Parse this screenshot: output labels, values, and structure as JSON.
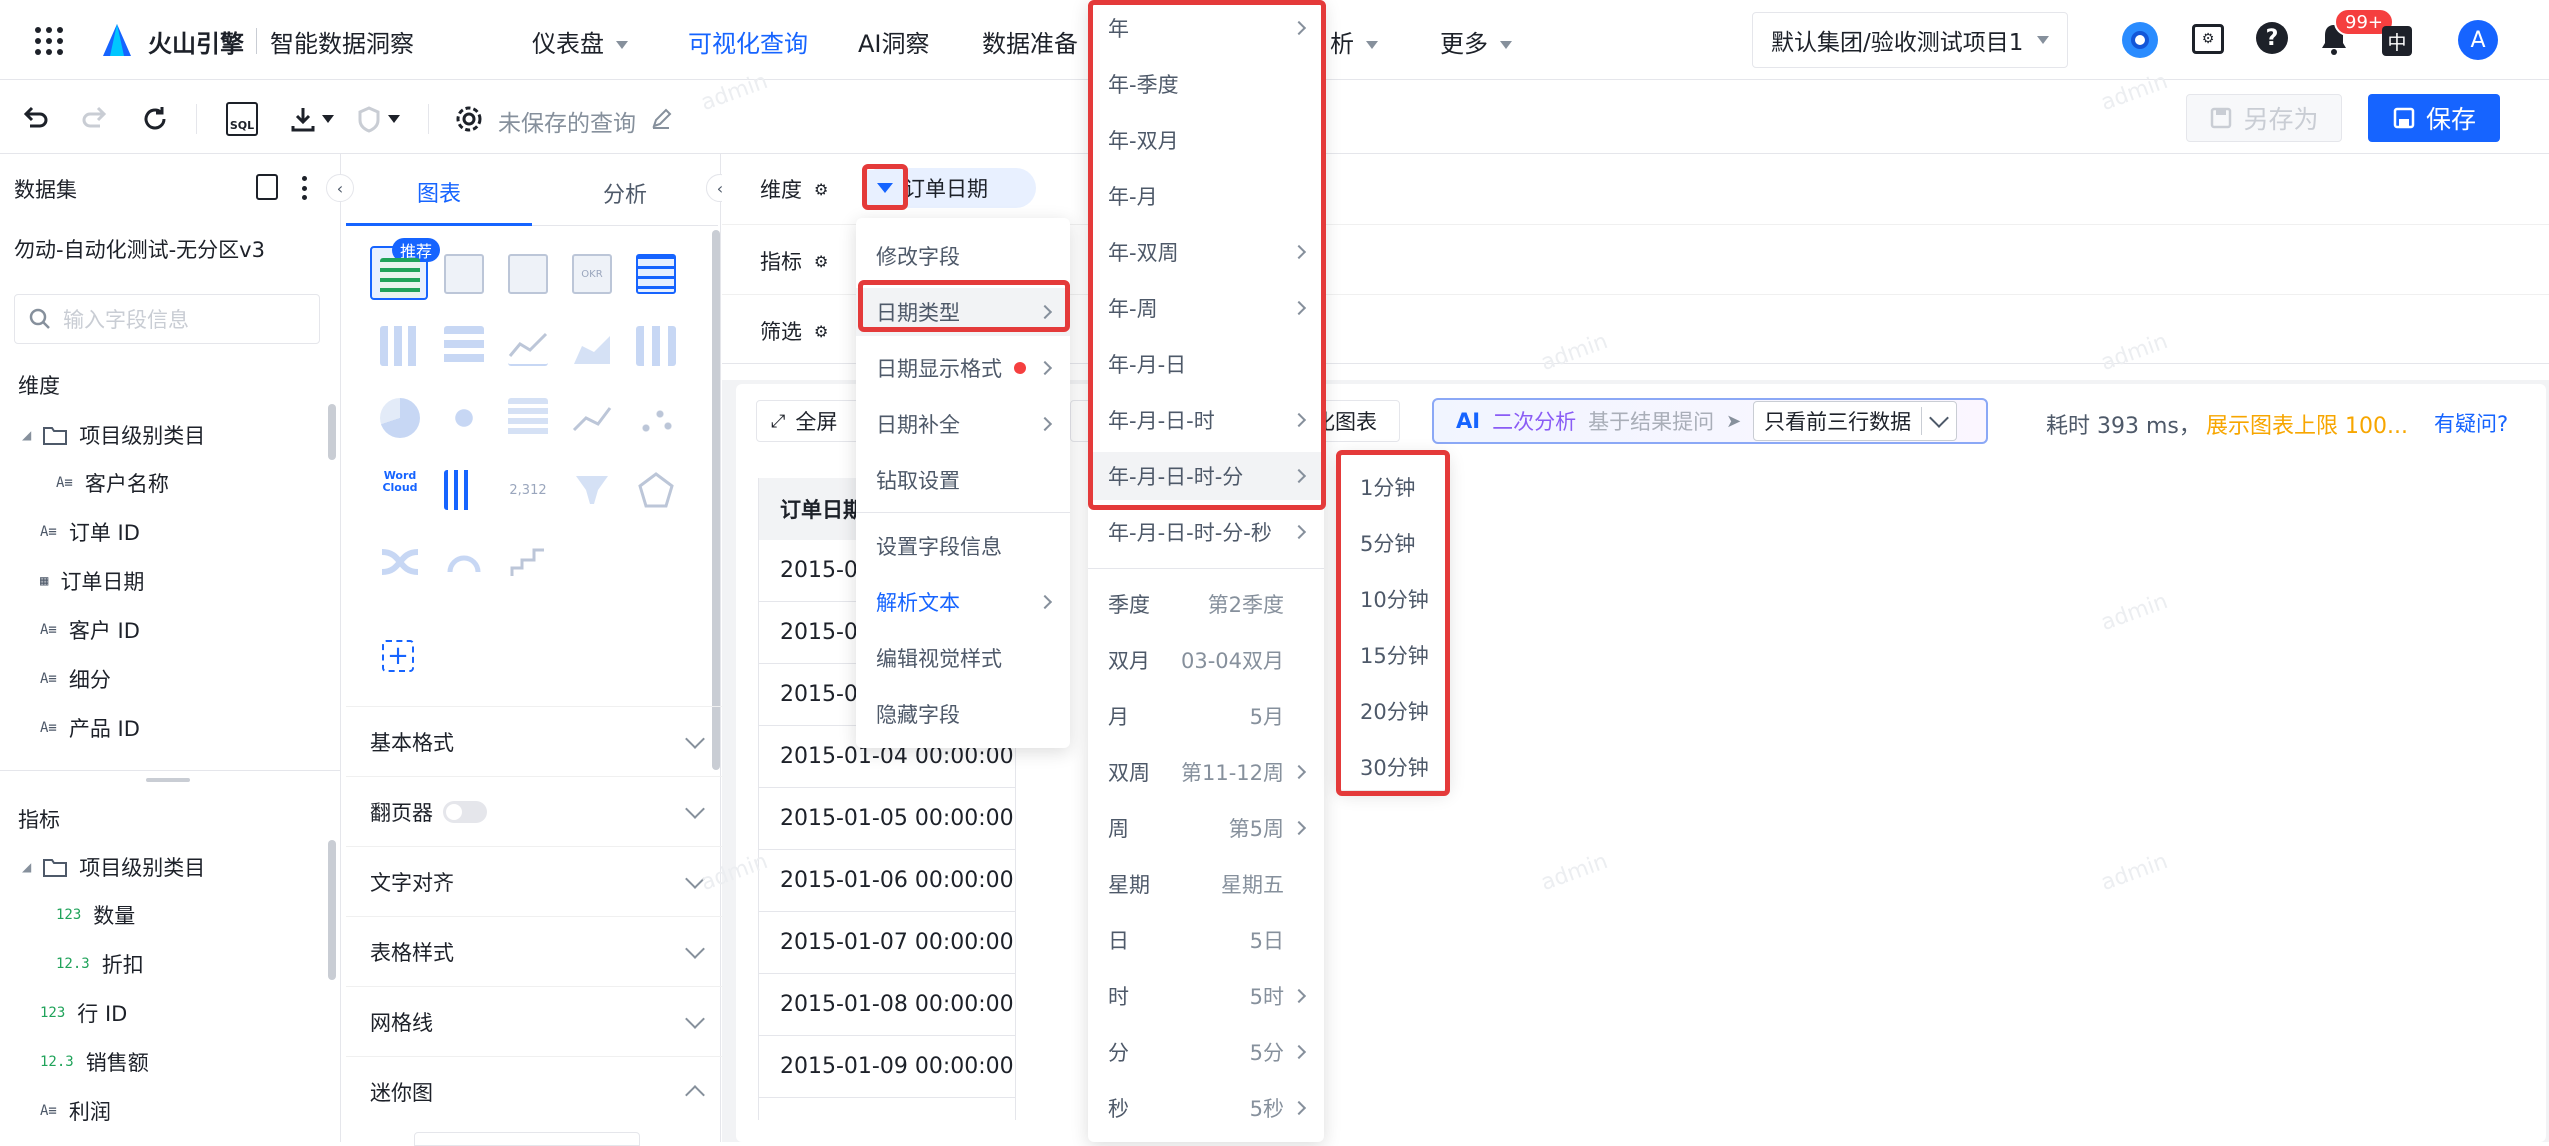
{
  "brand": {
    "name": "火山引擎",
    "product": "智能数据洞察"
  },
  "nav": {
    "items": [
      {
        "label": "仪表盘",
        "dropdown": true
      },
      {
        "label": "可视化查询",
        "active": true
      },
      {
        "label": "AI洞察"
      },
      {
        "label": "数据准备"
      },
      {
        "label": "析",
        "dropdown": true
      },
      {
        "label": "更多",
        "dropdown": true
      }
    ],
    "project": "默认集团/验收测试项目1",
    "badge": "99+",
    "lang": "中",
    "avatar": "A"
  },
  "toolbar": {
    "title": "未保存的查询",
    "save_as": "另存为",
    "save": "保存",
    "sql": "SQL"
  },
  "dataset": {
    "label": "数据集",
    "name": "勿动-自动化测试-无分区v3",
    "search_placeholder": "输入字段信息",
    "dimension_label": "维度",
    "dimension_folder": "项目级别类目",
    "dimension_fields": [
      "客户名称",
      "订单 ID",
      "订单日期",
      "客户 ID",
      "细分",
      "产品 ID"
    ],
    "metric_label": "指标",
    "metric_folder": "项目级别类目",
    "metric_fields": [
      "数量",
      "折扣",
      "行 ID",
      "销售额",
      "利润"
    ]
  },
  "chart_panel": {
    "tabs": [
      "图表",
      "分析"
    ],
    "recommend_badge": "推荐",
    "sections": [
      "基本格式",
      "翻页器",
      "文字对齐",
      "表格样式",
      "网格线",
      "迷你图"
    ]
  },
  "query": {
    "dim_label": "维度",
    "metric_label": "指标",
    "filter_label": "筛选",
    "dim_chip": "订单日期",
    "fullscreen": "全屏",
    "chart_btn": "化图表",
    "ai_tag": "AI",
    "ai_title": "二次分析",
    "ai_placeholder": "基于结果提问",
    "ai_option": "只看前三行数据",
    "time_cost": "耗时 393 ms，",
    "limit_text": "展示图表上限 100...",
    "help": "有疑问?",
    "table_header": "订单日期",
    "rows": [
      "2015-0",
      "2015-0",
      "2015-0",
      "2015-01-04 00:00:00",
      "2015-01-05 00:00:00",
      "2015-01-06 00:00:00",
      "2015-01-07 00:00:00",
      "2015-01-08 00:00:00",
      "2015-01-09 00:00:00"
    ]
  },
  "field_menu": {
    "items": [
      "修改字段",
      "日期类型",
      "日期显示格式",
      "日期补全",
      "钻取设置",
      "设置字段信息",
      "解析文本",
      "编辑视觉样式",
      "隐藏字段"
    ]
  },
  "date_type_menu": {
    "items": [
      {
        "label": "年",
        "sub": true
      },
      {
        "label": "年-季度"
      },
      {
        "label": "年-双月"
      },
      {
        "label": "年-月"
      },
      {
        "label": "年-双周",
        "sub": true
      },
      {
        "label": "年-周",
        "sub": true
      },
      {
        "label": "年-月-日"
      },
      {
        "label": "年-月-日-时",
        "sub": true
      },
      {
        "label": "年-月-日-时-分",
        "sub": true
      },
      {
        "label": "年-月-日-时-分-秒",
        "sub": true
      }
    ],
    "parts": [
      {
        "label": "季度",
        "example": "第2季度"
      },
      {
        "label": "双月",
        "example": "03-04双月"
      },
      {
        "label": "月",
        "example": "5月"
      },
      {
        "label": "双周",
        "example": "第11-12周",
        "sub": true
      },
      {
        "label": "周",
        "example": "第5周",
        "sub": true
      },
      {
        "label": "星期",
        "example": "星期五"
      },
      {
        "label": "日",
        "example": "5日"
      },
      {
        "label": "时",
        "example": "5时",
        "sub": true
      },
      {
        "label": "分",
        "example": "5分",
        "sub": true
      },
      {
        "label": "秒",
        "example": "5秒",
        "sub": true
      }
    ]
  },
  "minute_menu": {
    "items": [
      "1分钟",
      "5分钟",
      "10分钟",
      "15分钟",
      "20分钟",
      "30分钟"
    ]
  },
  "watermark": "admin",
  "colors": {
    "primary": "#1664ff",
    "highlight": "#e43a3a",
    "warning": "#f7a600"
  }
}
